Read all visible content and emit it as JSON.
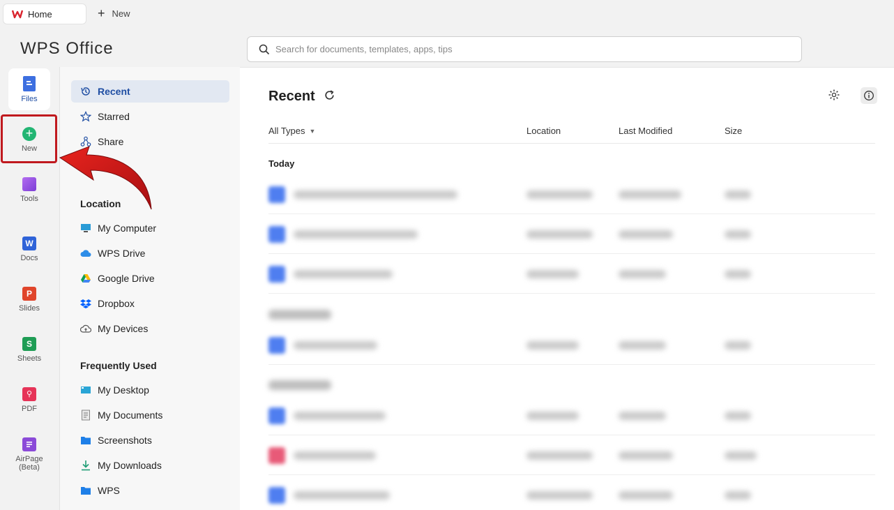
{
  "tabs": {
    "home": "Home",
    "new_tab": "New"
  },
  "brand": "WPS Office",
  "search": {
    "placeholder": "Search for documents, templates, apps, tips"
  },
  "rail": {
    "files": "Files",
    "new": "New",
    "tools": "Tools",
    "docs": "Docs",
    "slides": "Slides",
    "sheets": "Sheets",
    "pdf": "PDF",
    "airpage_line1": "AirPage",
    "airpage_line2": "(Beta)"
  },
  "sidebar": {
    "recent": "Recent",
    "starred": "Starred",
    "share": "Share",
    "location_heading": "Location",
    "my_computer": "My Computer",
    "wps_drive": "WPS Drive",
    "google_drive": "Google Drive",
    "dropbox": "Dropbox",
    "my_devices": "My Devices",
    "frequent_heading": "Frequently Used",
    "my_desktop": "My Desktop",
    "my_documents": "My Documents",
    "screenshots": "Screenshots",
    "my_downloads": "My Downloads",
    "wps": "WPS"
  },
  "main": {
    "title": "Recent",
    "filter": "All Types",
    "col_location": "Location",
    "col_modified": "Last Modified",
    "col_size": "Size",
    "group_today": "Today"
  },
  "colors": {
    "accent": "#1f4ea3",
    "highlight": "#c0191e",
    "new_green": "#22b573"
  }
}
